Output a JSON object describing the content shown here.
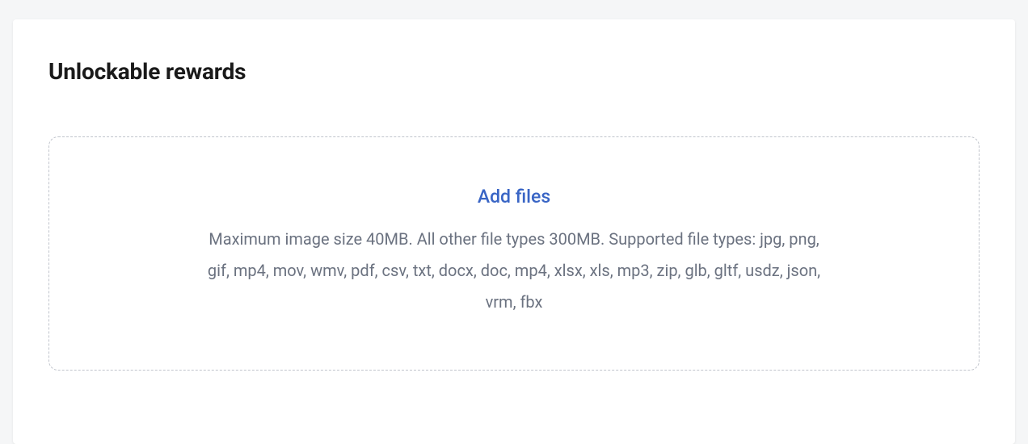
{
  "section": {
    "title": "Unlockable rewards"
  },
  "upload": {
    "add_files_label": "Add files",
    "help_text": "Maximum image size 40MB. All other file types 300MB. Supported file types: jpg, png, gif, mp4, mov, wmv, pdf, csv, txt, docx, doc, mp4, xlsx, xls, mp3, zip, glb, gltf, usdz, json, vrm, fbx"
  }
}
